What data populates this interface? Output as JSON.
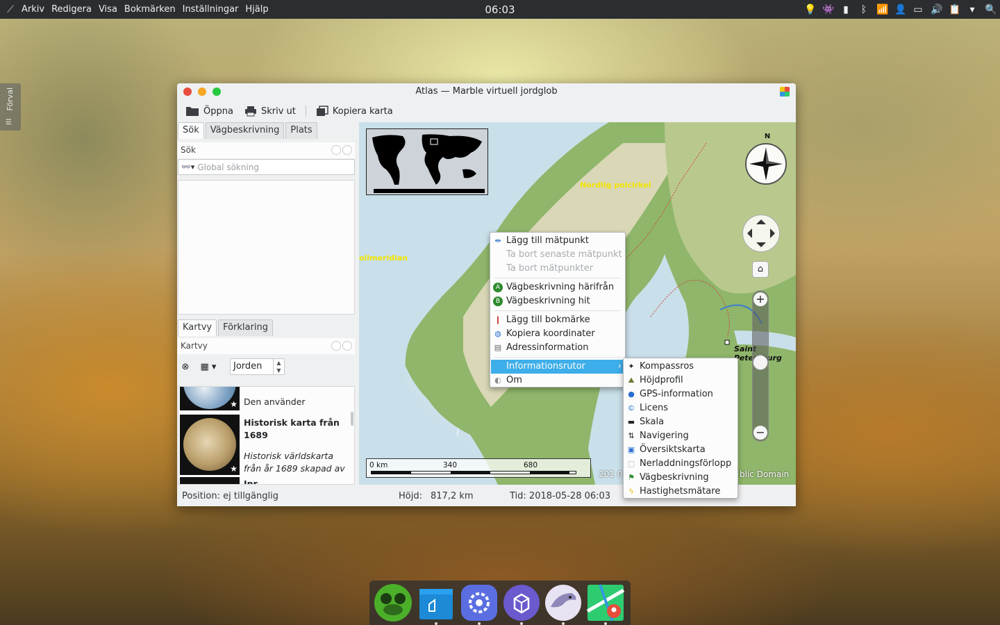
{
  "panel": {
    "menu": [
      {
        "label": "Arkiv"
      },
      {
        "label": "Redigera"
      },
      {
        "label": "Visa"
      },
      {
        "label": "Bokmärken"
      },
      {
        "label": "Inställningar"
      },
      {
        "label": "Hjälp"
      }
    ],
    "clock": "06:03",
    "tray_icons": [
      "lightbulb-icon",
      "ghost-icon",
      "battery-widget-icon",
      "bluetooth-icon",
      "wifi-icon",
      "user-icon",
      "battery-icon",
      "volume-icon",
      "clipboard-icon",
      "chevron-down-icon",
      "search-icon"
    ]
  },
  "edge_widget": {
    "label": "Förval"
  },
  "window": {
    "title": "Atlas — Marble virtuell jordglob",
    "toolbar": {
      "open": "Öppna",
      "print": "Skriv ut",
      "copy_map": "Kopiera karta"
    },
    "search_tabs": [
      "Sök",
      "Vägbeskrivning",
      "Plats"
    ],
    "search": {
      "section_label": "Sök",
      "placeholder": "Global sökning"
    },
    "map_tabs": [
      "Kartvy",
      "Förklaring"
    ],
    "mapview": {
      "section_label": "Kartvy",
      "celestial_body": "Jorden"
    },
    "maps": [
      {
        "title": "Den använder",
        "bold": false
      },
      {
        "title": "Historisk karta från 1689",
        "desc": "Historisk världskarta från år 1689 skapad av",
        "bold": true
      },
      {
        "title": "Inr...",
        "bold": true
      }
    ]
  },
  "map": {
    "labels": {
      "arctic_circle": "Nordlig polcirkel",
      "prime_meridian": "ollmeridian",
      "city": "Saint Petersburg",
      "credit_left": "201 0",
      "credit_right": "blic Domain"
    },
    "compass_n": "N",
    "scale": {
      "s0": "0 km",
      "s1": "340",
      "s2": "680"
    }
  },
  "status": {
    "position": "Position: ej tillgänglig",
    "altitude_label": "Höjd:",
    "altitude_value": "817,2 km",
    "time": "Tid: 2018-05-28 06:03"
  },
  "context_menu": {
    "items": [
      {
        "label": "Lägg till mätpunkt",
        "icon": "measure-icon"
      },
      {
        "label": "Ta bort senaste mätpunkt",
        "disabled": true
      },
      {
        "label": "Ta bort mätpunkter",
        "disabled": true
      },
      {
        "label": "Vägbeskrivning härifrån",
        "icon": "route-start-icon"
      },
      {
        "label": "Vägbeskrivning hit",
        "icon": "route-end-icon"
      },
      {
        "label": "Lägg till bokmärke",
        "icon": "bookmark-add-icon"
      },
      {
        "label": "Kopiera koordinater",
        "icon": "coordinates-icon"
      },
      {
        "label": "Adressinformation",
        "icon": "address-icon"
      },
      {
        "label": "Informationsrutor",
        "active": true
      },
      {
        "label": "Om",
        "icon": "globe-icon"
      }
    ]
  },
  "submenu": {
    "items": [
      {
        "label": "Kompassros",
        "icon": "compass-rose-icon"
      },
      {
        "label": "Höjdprofil",
        "icon": "elevation-icon"
      },
      {
        "label": "GPS-information",
        "icon": "gps-icon"
      },
      {
        "label": "Licens",
        "icon": "license-icon"
      },
      {
        "label": "Skala",
        "icon": "scale-icon"
      },
      {
        "label": "Navigering",
        "icon": "navigation-icon"
      },
      {
        "label": "Översiktskarta",
        "icon": "overview-map-icon"
      },
      {
        "label": "Nerladdningsförlopp",
        "icon": "download-progress-icon"
      },
      {
        "label": "Vägbeskrivning",
        "icon": "route-flag-icon"
      },
      {
        "label": "Hastighetsmätare",
        "icon": "speedometer-icon"
      }
    ]
  },
  "taskbar": {
    "apps": [
      "frog-app-icon",
      "file-manager-icon",
      "settings-icon",
      "package-icon",
      "eagle-browser-icon",
      "marble-maps-icon"
    ]
  },
  "colors": {
    "accent": "#3daee9",
    "panel": "#2b2d31",
    "arctic_label": "#f1e400"
  }
}
